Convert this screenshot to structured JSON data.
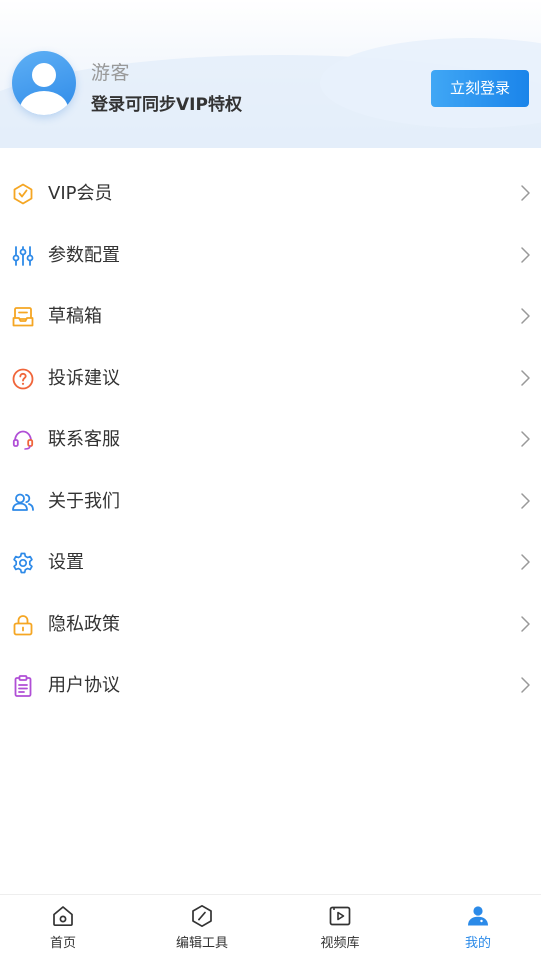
{
  "header": {
    "guest_name": "游客",
    "guest_subtitle": "登录可同步VIP特权",
    "login_button": "立刻登录"
  },
  "menu": {
    "items": [
      {
        "label": "VIP会员",
        "icon": "vip-badge-icon",
        "color": "#f5a623"
      },
      {
        "label": "参数配置",
        "icon": "sliders-icon",
        "color": "#2e8ae8"
      },
      {
        "label": "草稿箱",
        "icon": "drafts-inbox-icon",
        "color": "#f5a623"
      },
      {
        "label": "投诉建议",
        "icon": "question-circle-icon",
        "color": "#f0653a"
      },
      {
        "label": "联系客服",
        "icon": "headset-icon",
        "color": "#b04fd6"
      },
      {
        "label": "关于我们",
        "icon": "users-icon",
        "color": "#2e8ae8"
      },
      {
        "label": "设置",
        "icon": "gear-icon",
        "color": "#2e8ae8"
      },
      {
        "label": "隐私政策",
        "icon": "lock-icon",
        "color": "#f5a623"
      },
      {
        "label": "用户协议",
        "icon": "clipboard-icon",
        "color": "#b04fd6"
      }
    ]
  },
  "tabbar": {
    "tabs": [
      {
        "label": "首页",
        "icon": "home-icon"
      },
      {
        "label": "编辑工具",
        "icon": "edit-tool-icon"
      },
      {
        "label": "视频库",
        "icon": "video-library-icon"
      },
      {
        "label": "我的",
        "icon": "profile-icon",
        "active": true
      }
    ],
    "active_color": "#2b8ae8"
  }
}
